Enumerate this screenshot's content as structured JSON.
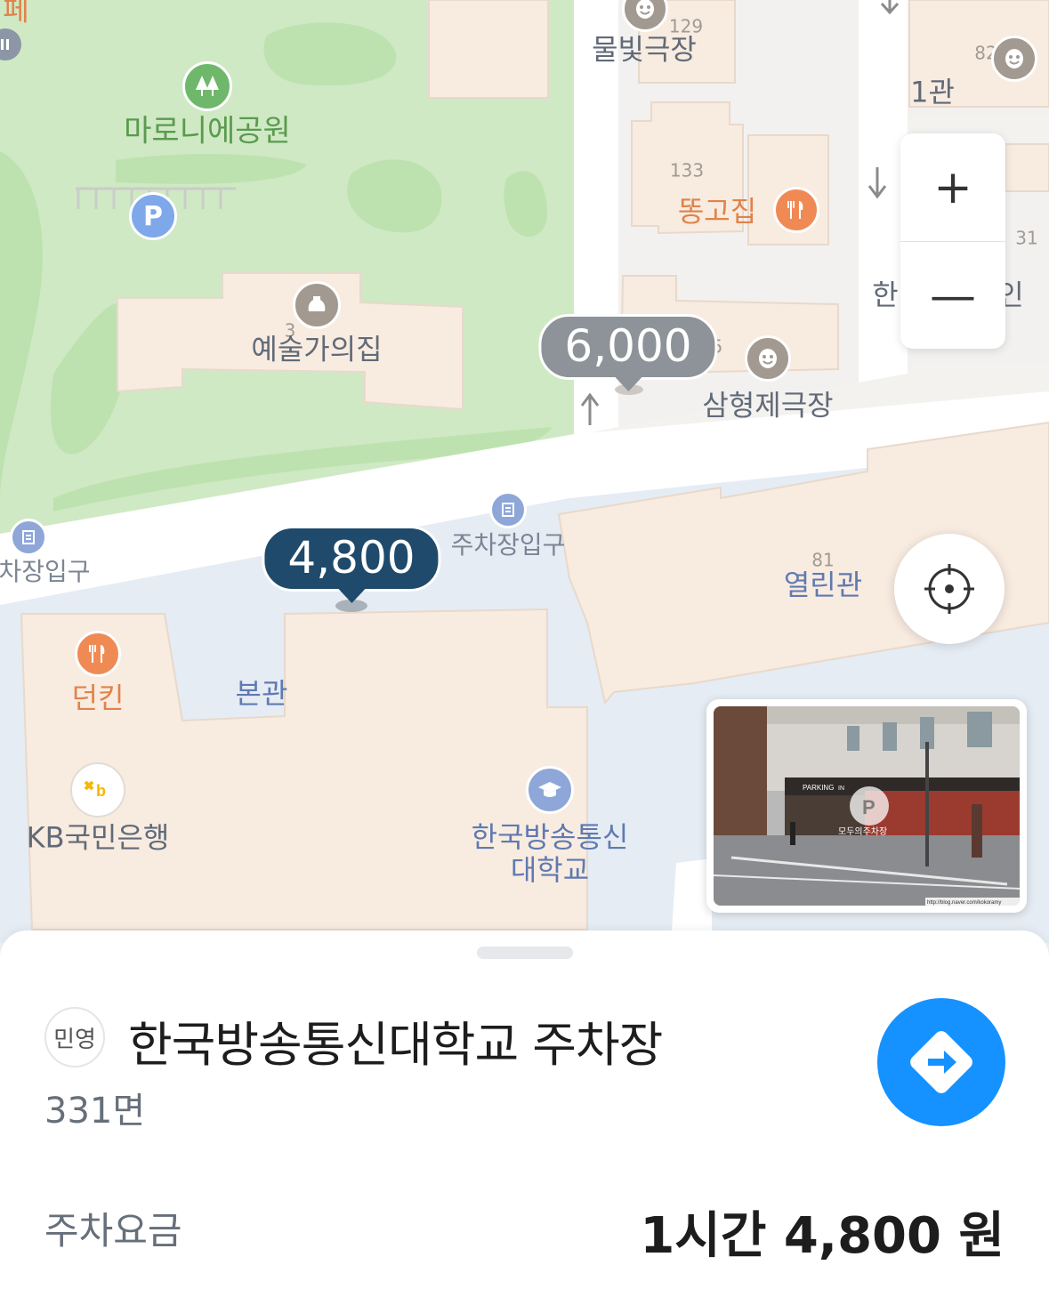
{
  "map": {
    "park_name": "마로니에공원",
    "labels": {
      "art_house": "예술가의집",
      "mulbit": "물빛극장",
      "mulbit_num": "129",
      "ttonggo": "똥고집",
      "ttonggo_num": "133",
      "samhyeong": "삼형제극장",
      "samhyeong_num": "5",
      "hall1": "1관",
      "hall1_num": "82",
      "num31": "31",
      "han_partial": "한",
      "in_partial": "인",
      "cafe_partial": "페",
      "art_num": "3",
      "parking_entry_right": "주차장입구",
      "parking_entry_left": "차장입구",
      "yeollin": "열린관",
      "yeollin_num": "81",
      "dunkin": "던킨",
      "bongwan": "본관",
      "kb": "KB국민은행",
      "university": "한국방송통신\n대학교"
    },
    "price_markers": [
      {
        "price": "4,800",
        "selected": true,
        "color": "#1f4a6b"
      },
      {
        "price": "6,000",
        "selected": false,
        "color": "#8e9399"
      }
    ],
    "controls": {
      "zoom_in": "+",
      "zoom_out": "—",
      "locate_icon": "crosshair-icon"
    },
    "photo": {
      "sign_parking": "PARKING",
      "sign_in": "IN",
      "watermark": "모두의주차장",
      "credit": "http://blog.naver.com/kokoramy"
    },
    "colors": {
      "park": "#cde8c2",
      "building": "#f8ebe0",
      "road": "#ffffff",
      "campus": "#e5ecf4",
      "green_icon": "#6fb86b",
      "food_icon": "#f08a55",
      "blue_icon": "#8ea7d8"
    }
  },
  "sheet": {
    "badge": "민영",
    "title": "한국방송통신대학교 주차장",
    "spaces": "331면",
    "fee_label": "주차요금",
    "fee_value": "1시간 4,800 원",
    "nav_icon": "directions-icon",
    "accent": "#1592ff"
  }
}
